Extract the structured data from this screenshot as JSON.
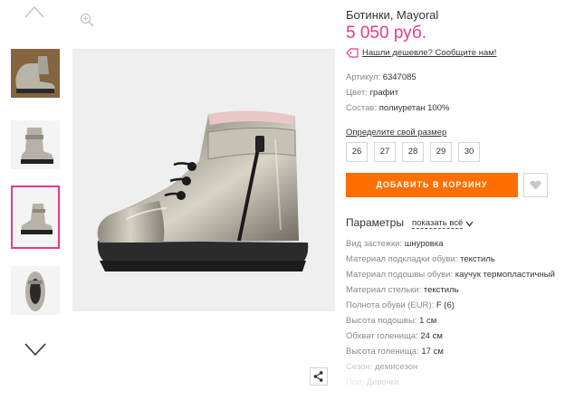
{
  "product": {
    "title": "Ботинки, Mayoral",
    "price": "5 050 руб.",
    "cheaper_link": "Нашли дешевле? Сообщите нам!"
  },
  "meta": {
    "article_label": "Артикул:",
    "article_value": "6347085",
    "color_label": "Цвет:",
    "color_value": "графит",
    "composition_label": "Состав:",
    "composition_value": "полиуретан 100%"
  },
  "sizes": {
    "link": "Определите свой размер",
    "options": [
      "26",
      "27",
      "28",
      "29",
      "30"
    ]
  },
  "actions": {
    "cart_label": "ДОБАВИТЬ В КОРЗИНУ"
  },
  "params": {
    "heading": "Параметры",
    "show_all": "показать всё",
    "items": [
      {
        "label": "Вид застежки:",
        "value": "шнуровка"
      },
      {
        "label": "Материал подкладки обуви:",
        "value": "текстиль"
      },
      {
        "label": "Материал подошвы обуви:",
        "value": "каучук термопластичный"
      },
      {
        "label": "Материал стельки:",
        "value": "текстиль"
      },
      {
        "label": "Полнота обуви (EUR):",
        "value": "F (6)"
      },
      {
        "label": "Высота подошвы:",
        "value": "1 см"
      },
      {
        "label": "Обхват голенища:",
        "value": "24 см"
      },
      {
        "label": "Высота голенища:",
        "value": "17 см"
      },
      {
        "label": "Сезон:",
        "value": "демисезон"
      },
      {
        "label": "Пол:",
        "value": "Девочки"
      }
    ]
  },
  "colors": {
    "accent_pink": "#e8388a",
    "cta_orange": "#ff6f00"
  },
  "icons": [
    "chevron-up-icon",
    "chevron-down-icon",
    "zoom-icon",
    "tag-icon",
    "heart-icon",
    "share-icon"
  ]
}
